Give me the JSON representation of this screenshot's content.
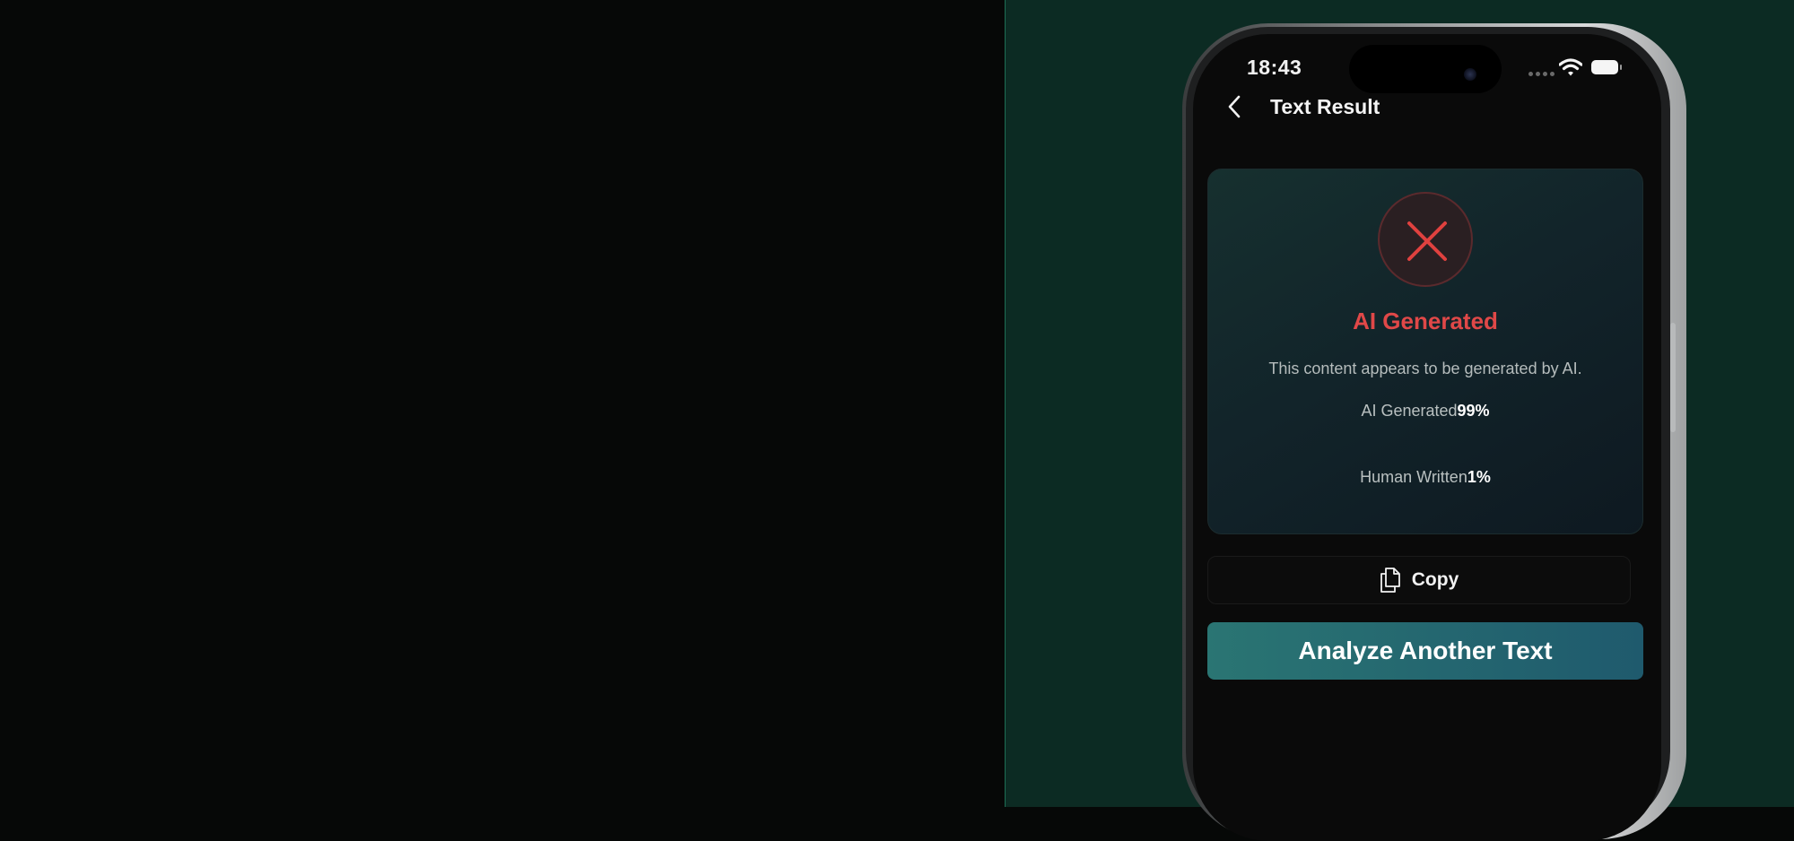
{
  "status_bar": {
    "time": "18:43"
  },
  "header": {
    "title": "Text Result"
  },
  "result": {
    "verdict": "AI Generated",
    "description": "This content appears to be generated by AI.",
    "ai_label": "AI Generated",
    "ai_value": "99%",
    "human_label": "Human Written",
    "human_value": "1%"
  },
  "actions": {
    "copy_label": "Copy",
    "analyze_label": "Analyze Another Text"
  },
  "colors": {
    "verdict_red": "#e04848",
    "accent_teal": "#2a7573",
    "panel_green": "#0c2b23"
  },
  "icons": [
    "back-chevron-icon",
    "close-x-icon",
    "copy-icon",
    "wifi-icon",
    "battery-icon"
  ]
}
